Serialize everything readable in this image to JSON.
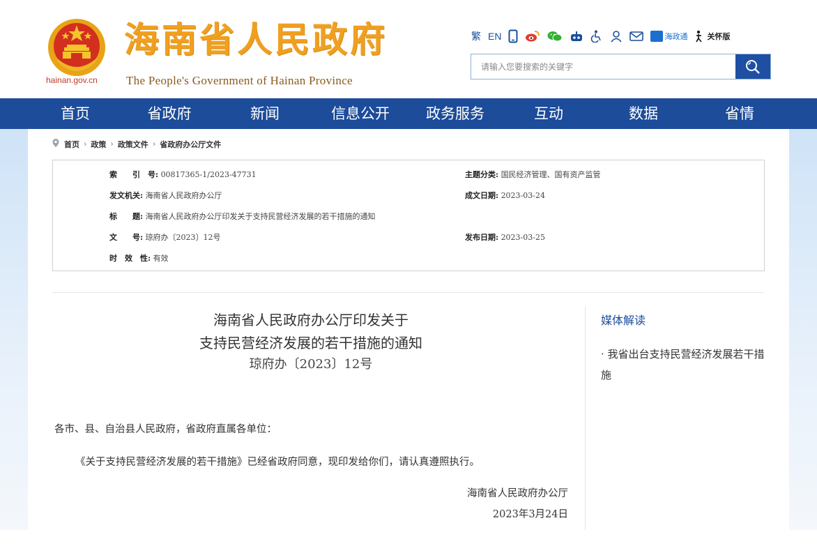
{
  "header": {
    "domain": "hainan.gov.cn",
    "title": "海南省人民政府",
    "subtitle": "The People's Government  of Hainan Province",
    "tools": {
      "traditional": "繁",
      "english": "EN",
      "haizhengtong": "海政通",
      "care_mode": "关怀版"
    },
    "search_placeholder": "请输入您要搜索的关键字"
  },
  "nav": [
    "首页",
    "省政府",
    "新闻",
    "信息公开",
    "政务服务",
    "互动",
    "数据",
    "省情"
  ],
  "breadcrumb": [
    "首页",
    "政策",
    "政策文件",
    "省政府办公厅文件"
  ],
  "info": {
    "index_label": "索　　引　号:",
    "index_value": "00817365-1/2023-47731",
    "topic_label": "主题分类:",
    "topic_value": "国民经济管理、国有资产监管",
    "issuer_label": "发文机关:",
    "issuer_value": "海南省人民政府办公厅",
    "created_label": "成文日期:",
    "created_value": "2023-03-24",
    "title_label": "标　　题:",
    "title_value": "海南省人民政府办公厅印发关于支持民营经济发展的若干措施的通知",
    "docno_label": "文　　号:",
    "docno_value": "琼府办〔2023〕12号",
    "published_label": "发布日期:",
    "published_value": "2023-03-25",
    "validity_label": "时　效　性:",
    "validity_value": "有效"
  },
  "article": {
    "title_line1": "海南省人民政府办公厅印发关于",
    "title_line2": "支持民营经济发展的若干措施的通知",
    "doc_number": "琼府办〔2023〕12号",
    "salutation": "各市、县、自治县人民政府，省政府直属各单位：",
    "body": "《关于支持民营经济发展的若干措施》已经省政府同意，现印发给你们，请认真遵照执行。",
    "signature": "海南省人民政府办公厅",
    "date": "2023年3月24日"
  },
  "sidebar": {
    "title": "媒体解读",
    "link": "· 我省出台支持民营经济发展若干措施"
  },
  "colors": {
    "nav_bg": "#1c4c9a",
    "title_gold": "#f0a020",
    "link_blue": "#1c4c9a"
  }
}
